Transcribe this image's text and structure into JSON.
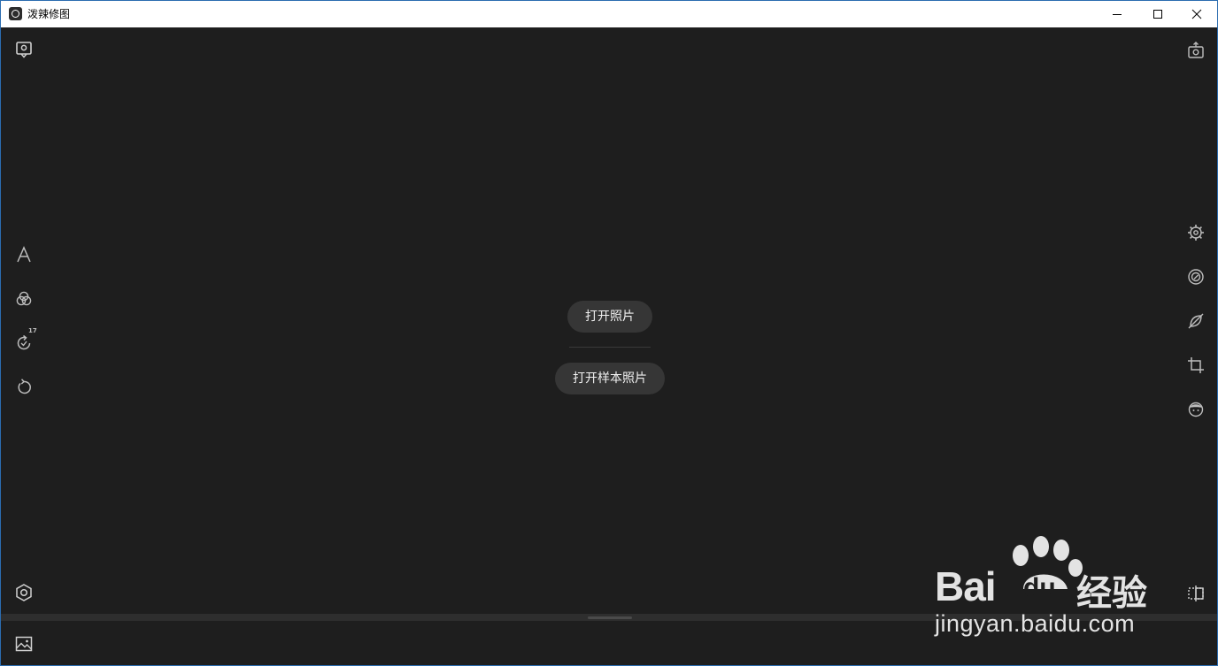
{
  "window": {
    "title": "泼辣修图"
  },
  "center": {
    "open_photo_label": "打开照片",
    "open_sample_label": "打开样本照片"
  },
  "left_toolbar": {
    "history_badge": "17"
  },
  "watermark": {
    "brand": "Bai",
    "brand_du": "du",
    "brand_suffix": "经验",
    "url": "jingyan.baidu.com"
  },
  "colors": {
    "background": "#1e1e1e",
    "titlebar": "#ffffff",
    "button": "#363636",
    "icon": "#bdbdbd"
  },
  "icons": {
    "top_left": "import-photo-icon",
    "text_tool": "text-icon",
    "presets": "filters-icon",
    "history": "history-icon",
    "reset": "reset-icon",
    "settings": "settings-icon",
    "export": "export-icon",
    "adjust": "gear-adjust-icon",
    "lens": "lens-icon",
    "brush": "brush-icon",
    "crop": "crop-icon",
    "face": "face-icon",
    "compare": "compare-icon",
    "gallery": "gallery-icon"
  }
}
